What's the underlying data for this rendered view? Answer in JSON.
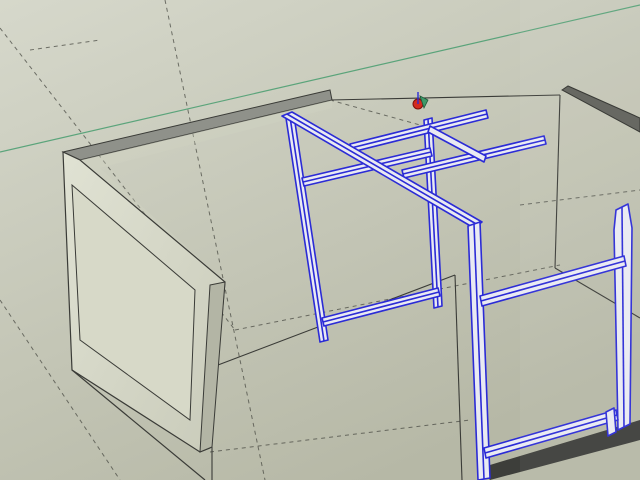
{
  "app": {
    "type": "3d-modeling-viewport"
  },
  "colors": {
    "background_top": "#d4d6c9",
    "background_bottom": "#b9bba9",
    "selection_blue": "#2b2bd6",
    "selection_blue_dark": "#14148a",
    "wall_face": "#d8dac9",
    "wall_top": "#8f918a",
    "wall_edge": "#3a3b37",
    "axis_green": "#3f9a6a",
    "axis_red": "#d42a1f",
    "dashed_edge": "#4a4b44"
  },
  "icons": {
    "model_origin": "axes-gizmo-icon"
  }
}
